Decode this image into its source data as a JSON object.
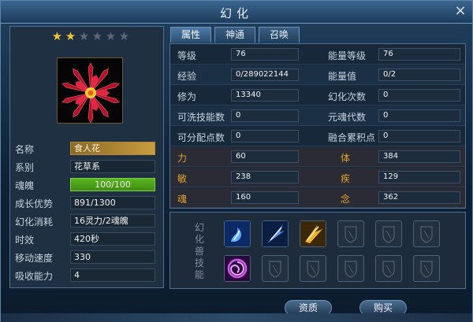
{
  "window": {
    "title": "幻化",
    "close_label": "×"
  },
  "left": {
    "star_rating": 2,
    "star_max": 6,
    "stats": [
      {
        "label": "名称",
        "value": "食人花",
        "style": "gold"
      },
      {
        "label": "系别",
        "value": "花草系"
      },
      {
        "label": "魂魄",
        "value": "100/100",
        "style": "green"
      },
      {
        "label": "成长优势",
        "value": "891/1300"
      },
      {
        "label": "幻化消耗",
        "value": "16灵力/2魂魄"
      },
      {
        "label": "时效",
        "value": "420秒"
      },
      {
        "label": "移动速度",
        "value": "330"
      },
      {
        "label": "吸收能力",
        "value": "4"
      }
    ]
  },
  "tabs": [
    {
      "label": "属性"
    },
    {
      "label": "神通"
    },
    {
      "label": "召唤"
    }
  ],
  "attributes": {
    "rows": [
      [
        {
          "label": "等级",
          "value": "76"
        },
        {
          "label": "能量等级",
          "value": "76"
        }
      ],
      [
        {
          "label": "经验",
          "value": "0/289022144"
        },
        {
          "label": "能量值",
          "value": "0/2"
        }
      ],
      [
        {
          "label": "修为",
          "value": "13340"
        },
        {
          "label": "幻化次数",
          "value": "0"
        }
      ],
      [
        {
          "label": "可洗技能数",
          "value": "0"
        },
        {
          "label": "元魂代数",
          "value": "0"
        }
      ],
      [
        {
          "label": "可分配点数",
          "value": "0"
        },
        {
          "label": "融合累积点",
          "value": "0"
        }
      ],
      [
        {
          "label": "力",
          "value": "60"
        },
        {
          "label": "体",
          "value": "384"
        }
      ],
      [
        {
          "label": "敏",
          "value": "238"
        },
        {
          "label": "疾",
          "value": "129"
        }
      ],
      [
        {
          "label": "魂",
          "value": "160"
        },
        {
          "label": "念",
          "value": "362"
        }
      ]
    ]
  },
  "skills": {
    "label": "幻化兽技能",
    "slots": [
      {
        "icon": "blue-wave-skill-icon",
        "filled": true
      },
      {
        "icon": "blue-slash-skill-icon",
        "filled": true
      },
      {
        "icon": "gold-claw-skill-icon",
        "filled": true
      },
      {
        "icon": "empty-slot-icon",
        "filled": false
      },
      {
        "icon": "empty-slot-icon",
        "filled": false
      },
      {
        "icon": "empty-slot-icon",
        "filled": false
      },
      {
        "icon": "purple-vortex-skill-icon",
        "filled": true
      },
      {
        "icon": "empty-slot-icon",
        "filled": false
      },
      {
        "icon": "empty-slot-icon",
        "filled": false
      },
      {
        "icon": "empty-slot-icon",
        "filled": false
      },
      {
        "icon": "empty-slot-icon",
        "filled": false
      },
      {
        "icon": "empty-slot-icon",
        "filled": false
      }
    ]
  },
  "buttons": {
    "aptitude": "资质",
    "buy": "购买"
  },
  "colors": {
    "gold": "#e0a42c",
    "green_bar": "#58b51f",
    "star_on": "#f0c23a"
  }
}
